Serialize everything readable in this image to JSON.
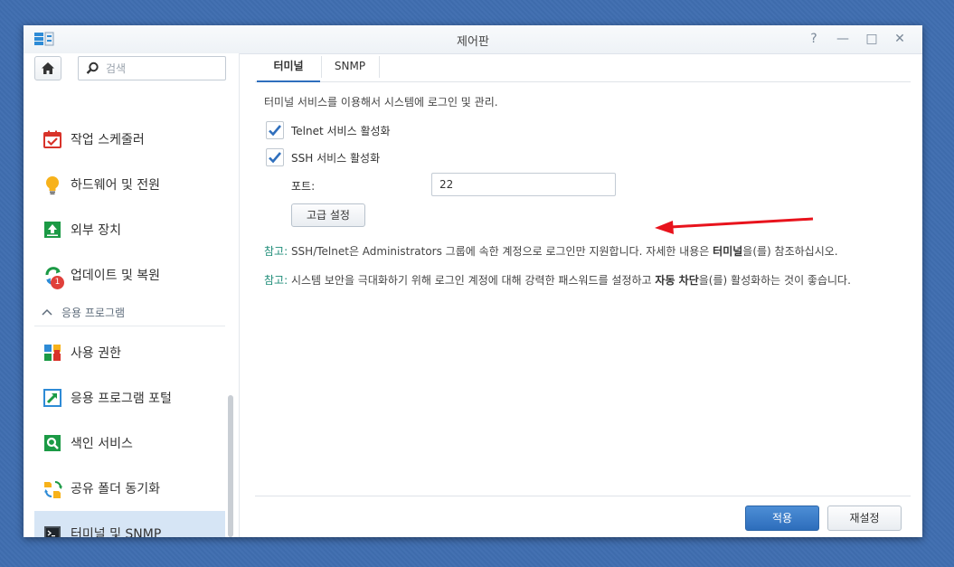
{
  "window": {
    "title": "제어판",
    "controls": {
      "help": "?",
      "minimize": "—",
      "maximize": "□",
      "close": "✕"
    }
  },
  "sidebar": {
    "search_placeholder": "검색",
    "items": [
      {
        "label": "작업 스케줄러",
        "icon": "calendar-check-icon"
      },
      {
        "label": "하드웨어 및 전원",
        "icon": "lightbulb-icon"
      },
      {
        "label": "외부 장치",
        "icon": "external-device-icon"
      },
      {
        "label": "업데이트 및 복원",
        "icon": "update-restore-icon",
        "badge": "1"
      },
      {
        "label": "사용 권한",
        "icon": "app-privileges-icon"
      },
      {
        "label": "응용 프로그램 포털",
        "icon": "app-portal-icon"
      },
      {
        "label": "색인 서비스",
        "icon": "indexing-service-icon"
      },
      {
        "label": "공유 폴더 동기화",
        "icon": "shared-folder-sync-icon"
      },
      {
        "label": "터미널 및 SNMP",
        "icon": "terminal-icon",
        "selected": true
      }
    ],
    "section_label": "응용 프로그램"
  },
  "tabs": [
    {
      "label": "터미널",
      "active": true
    },
    {
      "label": "SNMP",
      "active": false
    }
  ],
  "content": {
    "description": "터미널 서비스를 이용해서 시스템에 로그인 및 관리.",
    "telnet_label": "Telnet 서비스 활성화",
    "telnet_checked": true,
    "ssh_label": "SSH 서비스 활성화",
    "ssh_checked": true,
    "port_label": "포트:",
    "port_value": "22",
    "advanced_button": "고급 설정",
    "note1_key": "참고:",
    "note1_a": " SSH/Telnet은 Administrators 그룹에 속한 계정으로 로그인만 지원합니다. 자세한 내용은 ",
    "note1_bold": "터미널",
    "note1_b": "을(를) 참조하십시오.",
    "note2_key": "참고:",
    "note2_a": " 시스템 보안을 극대화하기 위해 로그인 계정에 대해 강력한 패스워드를 설정하고 ",
    "note2_bold": "자동 차단",
    "note2_b": "을(를) 활성화하는 것이 좋습니다."
  },
  "footer": {
    "apply": "적용",
    "reset": "재설정"
  },
  "colors": {
    "accent": "#2f6fbd",
    "note_key": "#1e8c78",
    "arrow": "#e8131c",
    "desktop": "#3f6eb0"
  }
}
